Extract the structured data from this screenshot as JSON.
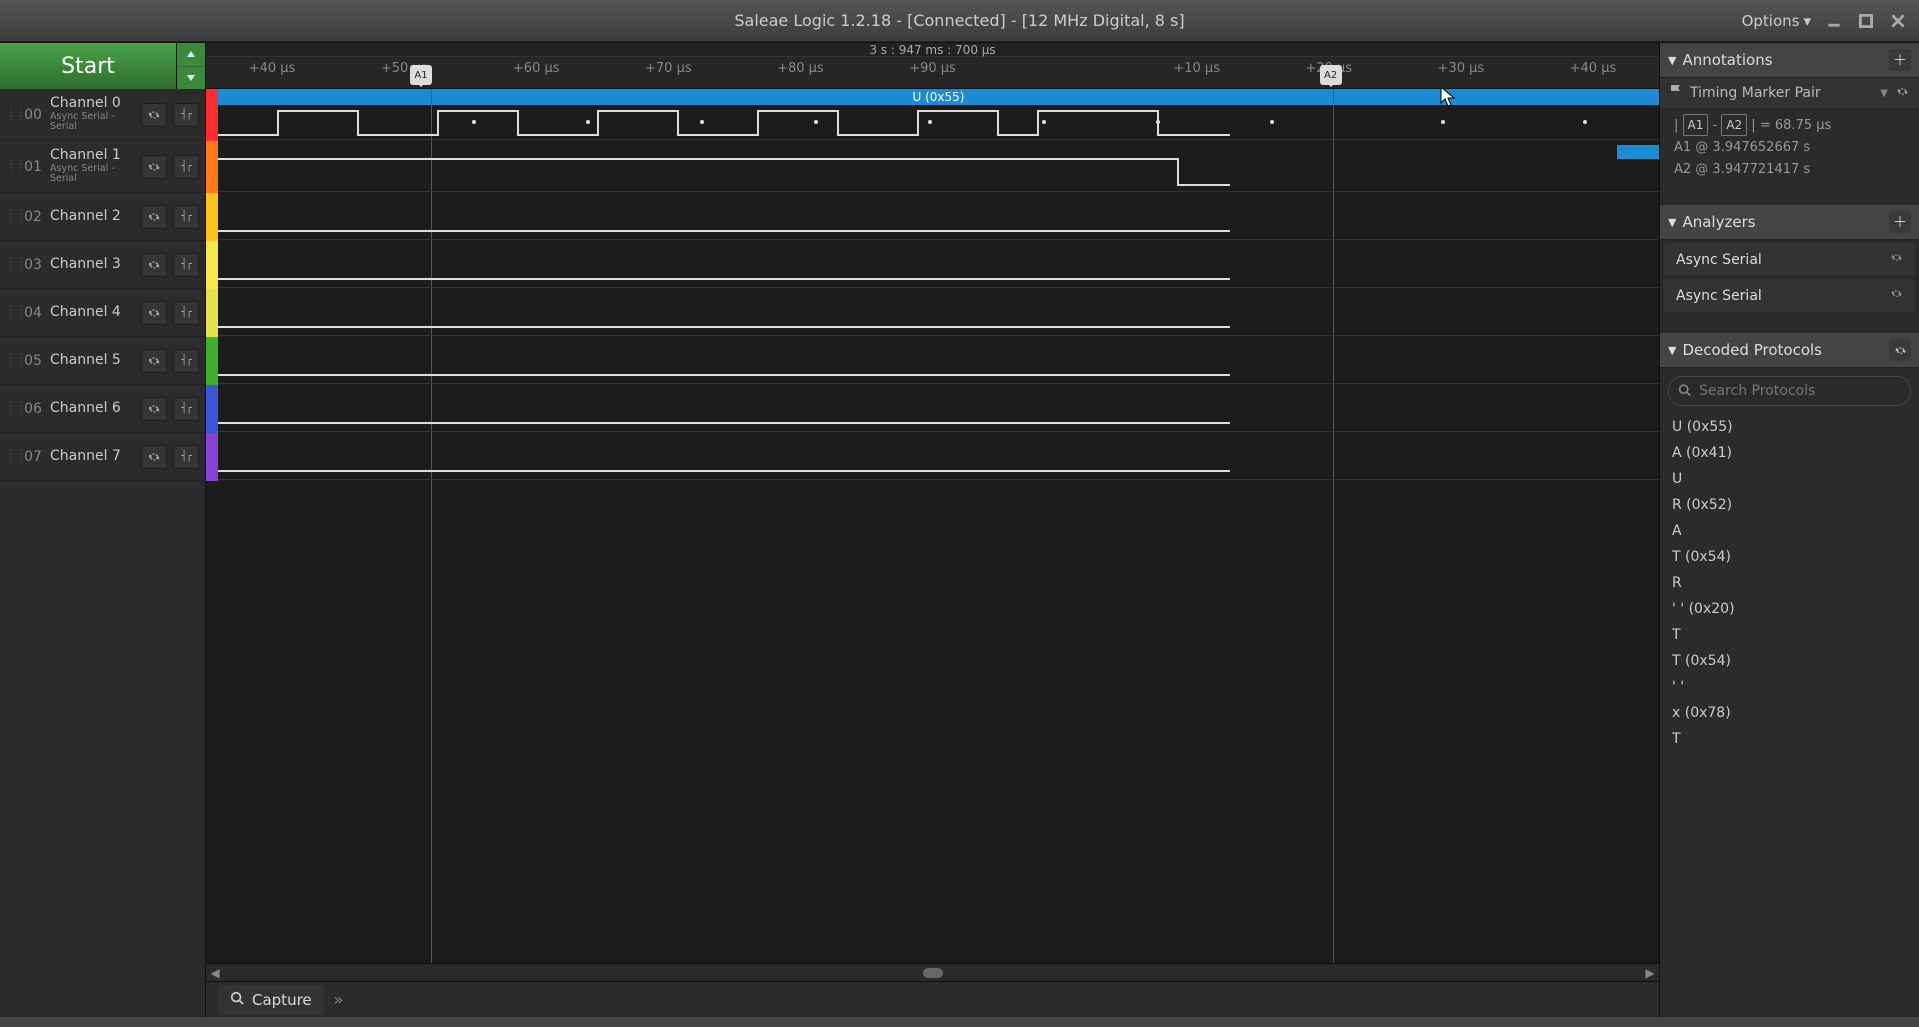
{
  "window": {
    "title": "Saleae Logic 1.2.18 - [Connected] - [12 MHz Digital, 8 s]",
    "options_label": "Options"
  },
  "start_label": "Start",
  "channels": [
    {
      "idx": "00",
      "name": "Channel 0",
      "sub": "Async Serial - Serial",
      "color": "#ff2d2d"
    },
    {
      "idx": "01",
      "name": "Channel 1",
      "sub": "Async Serial - Serial",
      "color": "#ff7a1a"
    },
    {
      "idx": "02",
      "name": "Channel 2",
      "sub": "",
      "color": "#ffc21a"
    },
    {
      "idx": "03",
      "name": "Channel 3",
      "sub": "",
      "color": "#f4e84b"
    },
    {
      "idx": "04",
      "name": "Channel 4",
      "sub": "",
      "color": "#e2e24b"
    },
    {
      "idx": "05",
      "name": "Channel 5",
      "sub": "",
      "color": "#3fae2a"
    },
    {
      "idx": "06",
      "name": "Channel 6",
      "sub": "",
      "color": "#3b55d9"
    },
    {
      "idx": "07",
      "name": "Channel 7",
      "sub": "",
      "color": "#8b3fd9"
    }
  ],
  "timeline": {
    "center_label": "3 s : 947 ms : 700 μs",
    "ticks": [
      "+40 μs",
      "+50 μs",
      "+60 μs",
      "+70 μs",
      "+80 μs",
      "+90 μs",
      "",
      "+10 μs",
      "+20 μs",
      "+30 μs",
      "+40 μs"
    ],
    "marker_a1_pos_pct": 14.8,
    "marker_a2_pos_pct": 77.4,
    "marker_a1_label": "A1",
    "marker_a2_label": "A2",
    "decode_label": "U (0x55)",
    "cursor_pos_pct": 85
  },
  "annotations": {
    "title": "Annotations",
    "pair_title": "Timing Marker Pair",
    "diff_label_a1": "A1",
    "diff_label_a2": "A2",
    "diff_value": "= 68.75 μs",
    "a1_line": "A1   @   3.947652667 s",
    "a2_line": "A2   @   3.947721417 s"
  },
  "analyzers": {
    "title": "Analyzers",
    "items": [
      "Async Serial",
      "Async Serial"
    ]
  },
  "decoded": {
    "title": "Decoded Protocols",
    "search_placeholder": "Search Protocols",
    "items": [
      "U (0x55)",
      "A (0x41)",
      "U",
      "R (0x52)",
      "A",
      "T (0x54)",
      "R",
      "' ' (0x20)",
      "T",
      "T (0x54)",
      "' '",
      "x (0x78)",
      "T"
    ]
  },
  "footer": {
    "capture_label": "Capture"
  }
}
